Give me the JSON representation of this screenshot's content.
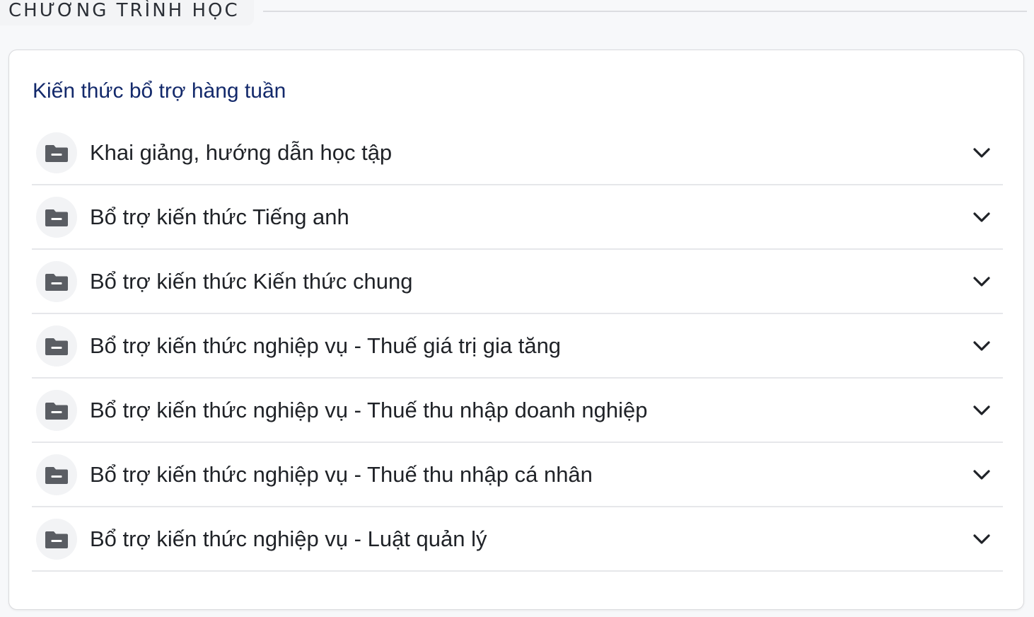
{
  "section": {
    "title": "CHƯƠNG TRÌNH HỌC"
  },
  "card": {
    "title": "Kiến thức bổ trợ hàng tuần",
    "items": [
      {
        "label": "Khai giảng, hướng dẫn học tập",
        "icon": "folder-minus-icon",
        "toggle_icon": "chevron-down-icon"
      },
      {
        "label": "Bổ trợ kiến thức Tiếng anh",
        "icon": "folder-minus-icon",
        "toggle_icon": "chevron-down-icon"
      },
      {
        "label": "Bổ trợ kiến thức Kiến thức chung",
        "icon": "folder-minus-icon",
        "toggle_icon": "chevron-down-icon"
      },
      {
        "label": "Bổ trợ kiến thức nghiệp vụ - Thuế giá trị gia tăng",
        "icon": "folder-minus-icon",
        "toggle_icon": "chevron-down-icon"
      },
      {
        "label": "Bổ trợ kiến thức nghiệp vụ - Thuế thu nhập doanh nghiệp",
        "icon": "folder-minus-icon",
        "toggle_icon": "chevron-down-icon"
      },
      {
        "label": "Bổ trợ kiến thức nghiệp vụ - Thuế thu nhập cá nhân",
        "icon": "folder-minus-icon",
        "toggle_icon": "chevron-down-icon"
      },
      {
        "label": "Bổ trợ kiến thức nghiệp vụ - Luật quản lý",
        "icon": "folder-minus-icon",
        "toggle_icon": "chevron-down-icon"
      }
    ]
  },
  "colors": {
    "card_title": "#13296b",
    "item_text": "#1f2227",
    "icon": "#5a5d63",
    "divider": "#e6e7ea",
    "page_bg": "#f7f8fa"
  }
}
